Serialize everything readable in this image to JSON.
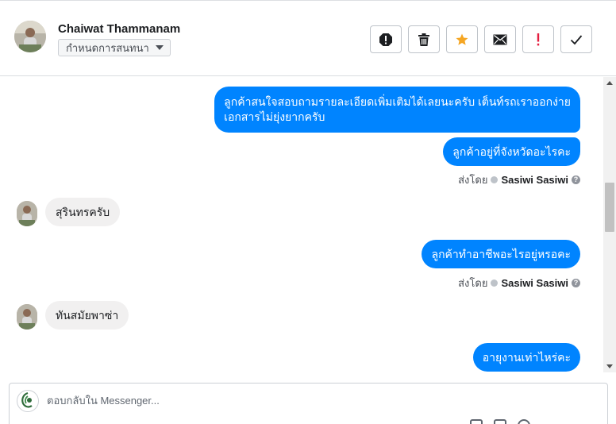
{
  "header": {
    "contact_name": "Chaiwat Thammanam",
    "assign_label": "กำหนดการสนทนา",
    "actions": [
      {
        "name": "spam-button",
        "icon": "exclamation-circle-icon"
      },
      {
        "name": "delete-button",
        "icon": "trash-icon"
      },
      {
        "name": "star-button",
        "icon": "star-icon",
        "color": "#f5a623"
      },
      {
        "name": "mark-unread-button",
        "icon": "envelope-icon"
      },
      {
        "name": "follow-up-button",
        "icon": "exclamation-icon",
        "color": "#e41e3f"
      },
      {
        "name": "mark-done-button",
        "icon": "checkmark-icon"
      }
    ]
  },
  "messages": {
    "out1_line1": "ลูกค้าสนใจสอบถามรายละเอียดเพิ่มเติมได้เลยนะครับ เต็นท์รถเราออกง่าย",
    "out1_line2": "เอกสารไม่ยุ่งยากครับ",
    "out2": "ลูกค้าอยู่ที่จังหวัดอะไรคะ",
    "in1": "สุรินทรครับ",
    "out3": "ลูกค้าทำอาชีพอะไรอยู่หรอคะ",
    "in2": "ทันสมัยพาซ่า",
    "out4": "อายุงานเท่าไหร่คะ"
  },
  "sent_by": {
    "prefix": "ส่งโดย",
    "name": "Sasiwi Sasiwi"
  },
  "reply": {
    "placeholder": "ตอบกลับใน Messenger..."
  },
  "colors": {
    "outgoing_bubble": "#0084ff",
    "incoming_bubble": "#f1f0f0"
  }
}
